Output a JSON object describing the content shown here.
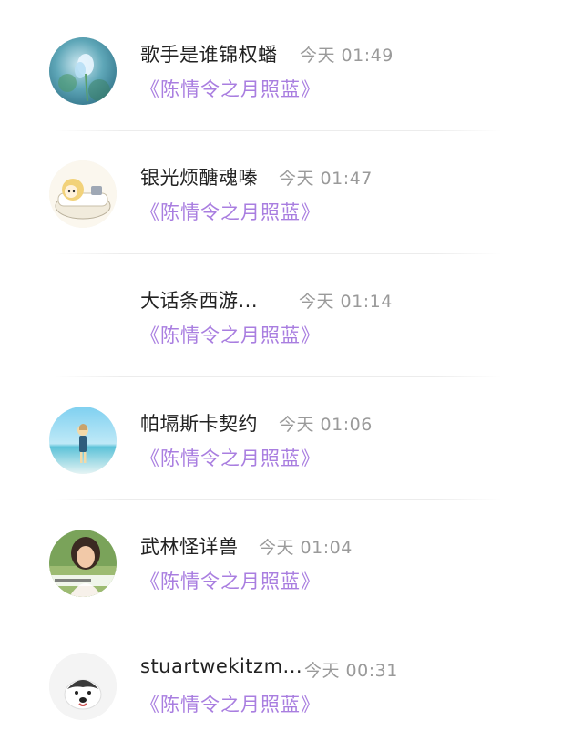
{
  "items": [
    {
      "avatar_icon": "avatar-flower-blue",
      "name": "歌手是谁锦权蟠",
      "time": "今天 01:49",
      "drama": "《陈情令之月照蓝》"
    },
    {
      "avatar_icon": "avatar-anime-character",
      "name": "银光烦醣魂嗪",
      "time": "今天 01:47",
      "drama": "《陈情令之月照蓝》"
    },
    {
      "avatar_icon": "avatar-blank",
      "name": "大话条西游...",
      "time": "今天 01:14",
      "drama": "《陈情令之月照蓝》"
    },
    {
      "avatar_icon": "avatar-anime-beach",
      "name": "帕塥斯卡契约",
      "time": "今天 01:06",
      "drama": "《陈情令之月照蓝》"
    },
    {
      "avatar_icon": "avatar-photo-person",
      "name": "武林怪详兽",
      "time": "今天 01:04",
      "drama": "《陈情令之月照蓝》"
    },
    {
      "avatar_icon": "avatar-dog",
      "name": "stuartwekitzm...",
      "time": "今天 00:31",
      "drama": "《陈情令之月照蓝》"
    }
  ],
  "colors": {
    "drama_accent": "#a97ee0",
    "name_text": "#222222",
    "time_text": "#9a9a9a"
  }
}
